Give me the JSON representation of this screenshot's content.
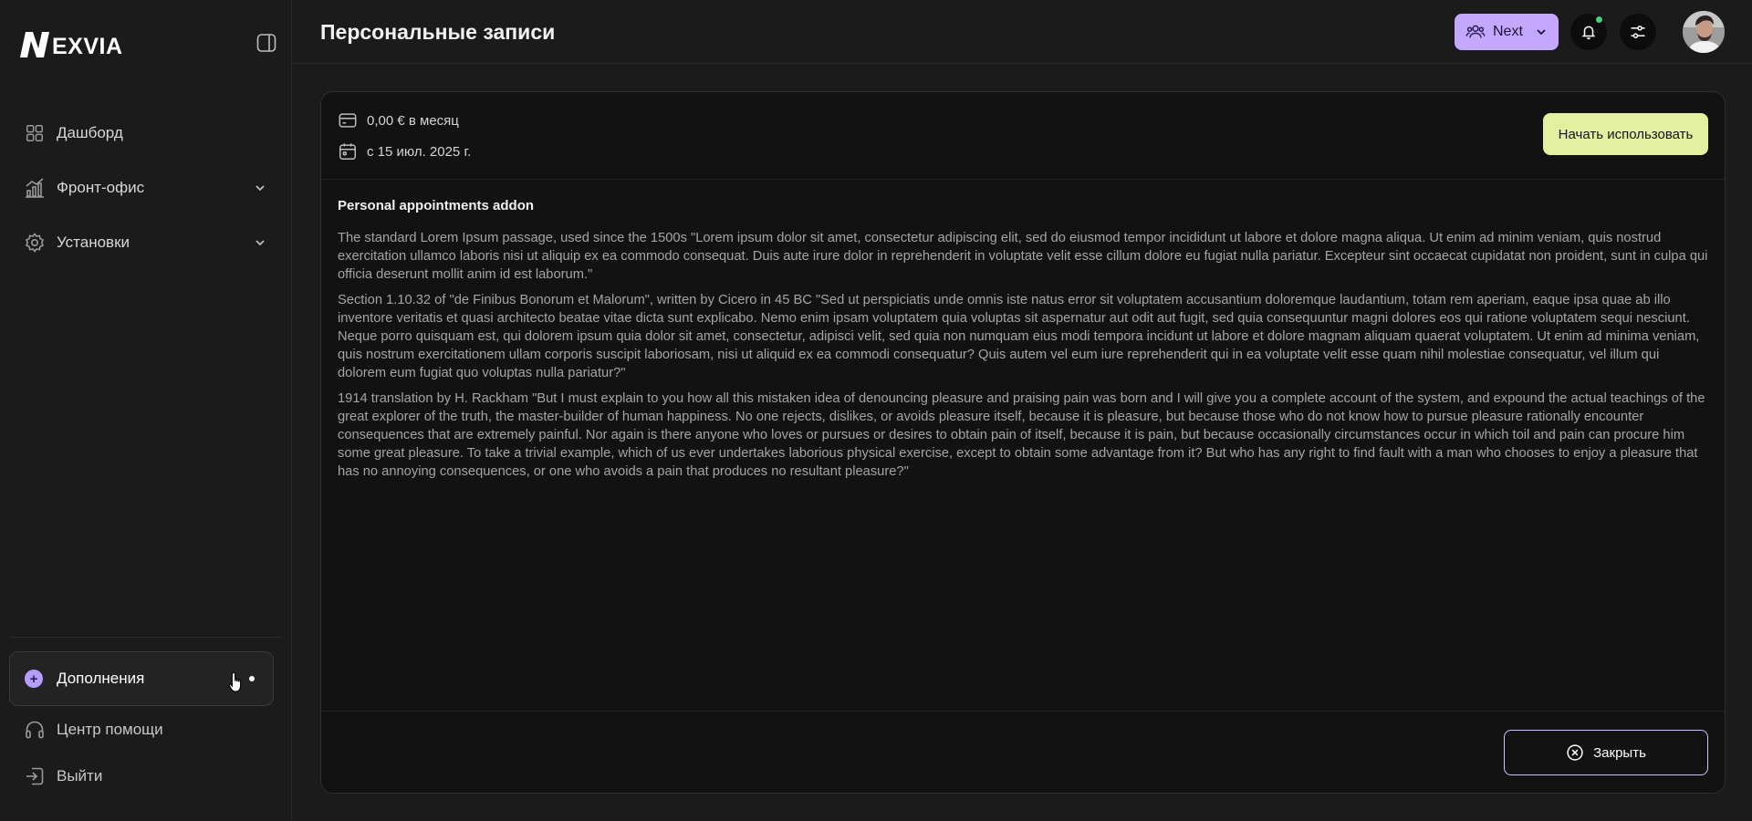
{
  "brand": {
    "logo_text": "EXVIA"
  },
  "sidebar": {
    "items": [
      {
        "label": "Дашборд",
        "icon": "grid-icon"
      },
      {
        "label": "Фронт-офис",
        "icon": "chart-icon",
        "expandable": true
      },
      {
        "label": "Установки",
        "icon": "gear-icon",
        "expandable": true
      }
    ],
    "addons": {
      "label": "Дополнения",
      "icon": "plus-circle-icon"
    },
    "help": {
      "label": "Центр помощи",
      "icon": "headphones-icon"
    },
    "logout": {
      "label": "Выйти",
      "icon": "logout-icon"
    }
  },
  "header": {
    "title": "Персональные записи",
    "next_label": "Next"
  },
  "panel": {
    "price": "0,00 € в месяц",
    "since": "с 15 июл. 2025 г.",
    "start_label": "Начать использовать",
    "addon_title": "Personal appointments addon",
    "paragraphs": [
      "The standard Lorem Ipsum passage, used since the 1500s \"Lorem ipsum dolor sit amet, consectetur adipiscing elit, sed do eiusmod tempor incididunt ut labore et dolore magna aliqua. Ut enim ad minim veniam, quis nostrud exercitation ullamco laboris nisi ut aliquip ex ea commodo consequat. Duis aute irure dolor in reprehenderit in voluptate velit esse cillum dolore eu fugiat nulla pariatur. Excepteur sint occaecat cupidatat non proident, sunt in culpa qui officia deserunt mollit anim id est laborum.\"",
      "Section 1.10.32 of \"de Finibus Bonorum et Malorum\", written by Cicero in 45 BC \"Sed ut perspiciatis unde omnis iste natus error sit voluptatem accusantium doloremque laudantium, totam rem aperiam, eaque ipsa quae ab illo inventore veritatis et quasi architecto beatae vitae dicta sunt explicabo. Nemo enim ipsam voluptatem quia voluptas sit aspernatur aut odit aut fugit, sed quia consequuntur magni dolores eos qui ratione voluptatem sequi nesciunt. Neque porro quisquam est, qui dolorem ipsum quia dolor sit amet, consectetur, adipisci velit, sed quia non numquam eius modi tempora incidunt ut labore et dolore magnam aliquam quaerat voluptatem. Ut enim ad minima veniam, quis nostrum exercitationem ullam corporis suscipit laboriosam, nisi ut aliquid ex ea commodi consequatur? Quis autem vel eum iure reprehenderit qui in ea voluptate velit esse quam nihil molestiae consequatur, vel illum qui dolorem eum fugiat quo voluptas nulla pariatur?\"",
      "1914 translation by H. Rackham \"But I must explain to you how all this mistaken idea of denouncing pleasure and praising pain was born and I will give you a complete account of the system, and expound the actual teachings of the great explorer of the truth, the master-builder of human happiness. No one rejects, dislikes, or avoids pleasure itself, because it is pleasure, but because those who do not know how to pursue pleasure rationally encounter consequences that are extremely painful. Nor again is there anyone who loves or pursues or desires to obtain pain of itself, because it is pain, but because occasionally circumstances occur in which toil and pain can procure him some great pleasure. To take a trivial example, which of us ever undertakes laborious physical exercise, except to obtain some advantage from it? But who has any right to find fault with a man who chooses to enjoy a pleasure that has no annoying consequences, or one who avoids a pain that produces no resultant pleasure?\""
    ],
    "close_label": "Закрыть"
  },
  "colors": {
    "accent_purple": "#c4a7ff",
    "accent_lime": "#e3f0a0",
    "status_online": "#46d17a"
  }
}
